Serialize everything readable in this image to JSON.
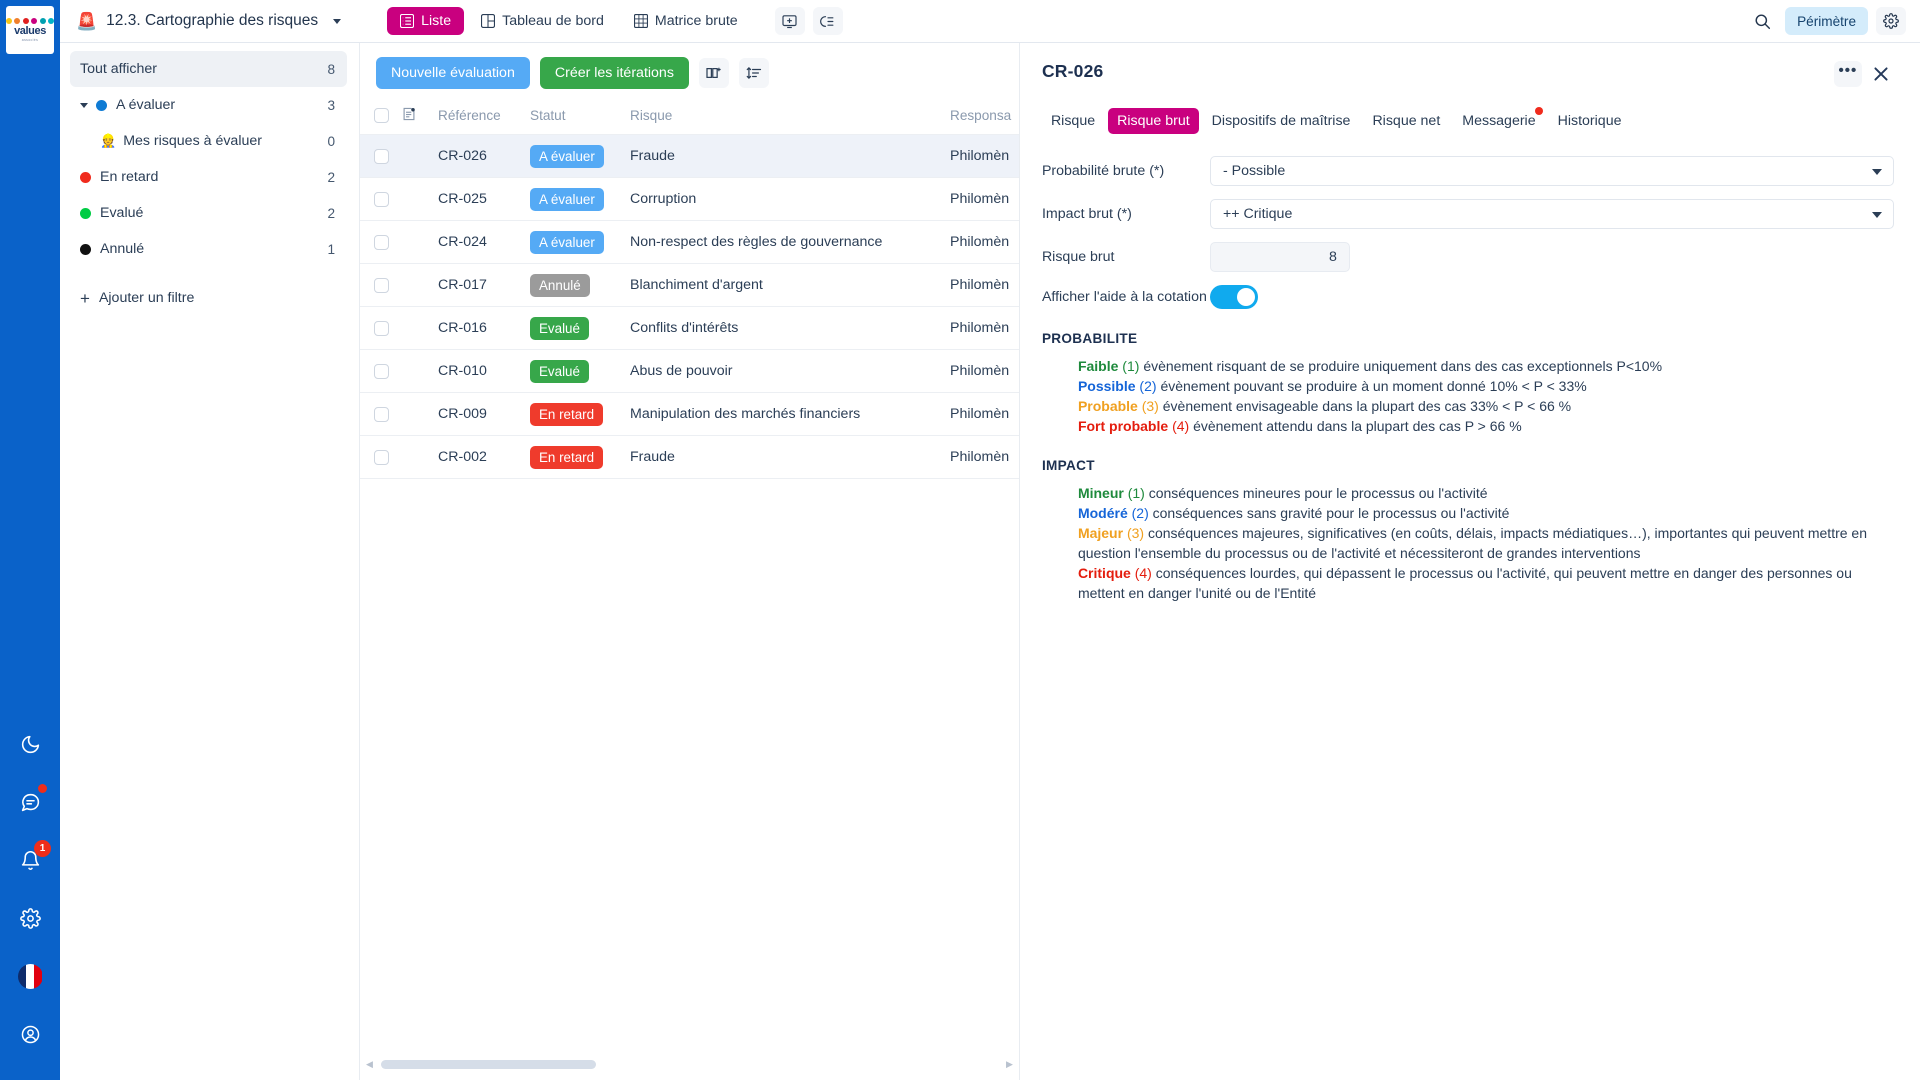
{
  "brand": {
    "logo_word": "values",
    "logo_sub": "associés",
    "logo_dot_colors": [
      "#f5c518",
      "#f07f2a",
      "#e02020",
      "#c9007f",
      "#00a0b0",
      "#00b3c8"
    ]
  },
  "topbar": {
    "app_emoji": "🚨",
    "app_title": "12.3. Cartographie des risques",
    "caret_icon": "chevron-down-icon",
    "tabs": [
      {
        "label": "Liste",
        "icon": "list-icon",
        "active": true
      },
      {
        "label": "Tableau de bord",
        "icon": "dashboard-icon",
        "active": false
      },
      {
        "label": "Matrice brute",
        "icon": "grid-icon",
        "active": false
      }
    ],
    "tools": [
      {
        "icon": "add-screen-icon"
      },
      {
        "icon": "collapse-list-icon"
      }
    ],
    "search_icon": "search-icon",
    "perimetre_label": "Périmètre",
    "gear_icon": "gear-icon"
  },
  "rail": {
    "icons": [
      {
        "name": "dark-mode-icon",
        "badge": null
      },
      {
        "name": "messages-icon",
        "badge": ""
      },
      {
        "name": "notifications-icon",
        "badge": "1"
      },
      {
        "name": "settings-icon",
        "badge": null
      },
      {
        "name": "language-flag-icon",
        "badge": null
      },
      {
        "name": "account-icon",
        "badge": null
      }
    ]
  },
  "filters": {
    "items": [
      {
        "label": "Tout afficher",
        "count": "8",
        "selected": true,
        "caret": false,
        "dot": null,
        "emoji": null,
        "indent": false
      },
      {
        "label": "A évaluer",
        "count": "3",
        "selected": false,
        "caret": true,
        "dot": "#0f7bd4",
        "emoji": null,
        "indent": false
      },
      {
        "label": "Mes risques à évaluer",
        "count": "0",
        "selected": false,
        "caret": false,
        "dot": null,
        "emoji": "👷",
        "indent": true
      },
      {
        "label": "En retard",
        "count": "2",
        "selected": false,
        "caret": false,
        "dot": "#f02b1d",
        "emoji": null,
        "indent": false
      },
      {
        "label": "Evalué",
        "count": "2",
        "selected": false,
        "caret": false,
        "dot": "#00cc44",
        "emoji": null,
        "indent": false
      },
      {
        "label": "Annulé",
        "count": "1",
        "selected": false,
        "caret": false,
        "dot": "#111111",
        "emoji": null,
        "indent": false
      }
    ],
    "add_filter_label": "Ajouter un filtre"
  },
  "list": {
    "buttons": {
      "new_evaluation": "Nouvelle évaluation",
      "create_iterations": "Créer les itérations"
    },
    "tools": [
      {
        "icon": "columns-add-icon"
      },
      {
        "icon": "sort-icon"
      }
    ],
    "columns": [
      "Référence",
      "Statut",
      "Risque",
      "Responsa"
    ],
    "header_note_icon": "note-icon",
    "rows": [
      {
        "flag": true,
        "ref": "CR-026",
        "status": "A évaluer",
        "status_type": "eval",
        "risk": "Fraude",
        "responsable": "Philomèn",
        "selected": true
      },
      {
        "flag": false,
        "ref": "CR-025",
        "status": "A évaluer",
        "status_type": "eval",
        "risk": "Corruption",
        "responsable": "Philomèn",
        "selected": false
      },
      {
        "flag": false,
        "ref": "CR-024",
        "status": "A évaluer",
        "status_type": "eval",
        "risk": "Non-respect des règles de gouvernance",
        "responsable": "Philomèn",
        "selected": false
      },
      {
        "flag": false,
        "ref": "CR-017",
        "status": "Annulé",
        "status_type": "annule",
        "risk": "Blanchiment d'argent",
        "responsable": "Philomèn",
        "selected": false
      },
      {
        "flag": false,
        "ref": "CR-016",
        "status": "Evalué",
        "status_type": "evalue",
        "risk": "Conflits d'intérêts",
        "responsable": "Philomèn",
        "selected": false
      },
      {
        "flag": false,
        "ref": "CR-010",
        "status": "Evalué",
        "status_type": "evalue",
        "risk": "Abus de pouvoir",
        "responsable": "Philomèn",
        "selected": false
      },
      {
        "flag": true,
        "ref": "CR-009",
        "status": "En retard",
        "status_type": "retard",
        "risk": "Manipulation des marchés financiers",
        "responsable": "Philomèn",
        "selected": false
      },
      {
        "flag": false,
        "ref": "CR-002",
        "status": "En retard",
        "status_type": "retard",
        "risk": "Fraude",
        "responsable": "Philomèn",
        "selected": false
      }
    ]
  },
  "detail": {
    "title": "CR-026",
    "more_icon": "more-options-icon",
    "close_icon": "close-icon",
    "tabs": [
      {
        "label": "Risque",
        "active": false,
        "dot": false
      },
      {
        "label": "Risque brut",
        "active": true,
        "dot": false
      },
      {
        "label": "Dispositifs de maîtrise",
        "active": false,
        "dot": false
      },
      {
        "label": "Risque net",
        "active": false,
        "dot": false
      },
      {
        "label": "Messagerie",
        "active": false,
        "dot": true
      },
      {
        "label": "Historique",
        "active": false,
        "dot": false
      }
    ],
    "form": {
      "probabilite_label": "Probabilité brute (*)",
      "probabilite_value": "- Possible",
      "impact_label": "Impact brut (*)",
      "impact_value": "++ Critique",
      "risque_brut_label": "Risque brut",
      "risque_brut_value": "8",
      "aide_label": "Afficher l'aide à la cotation",
      "aide_on": true
    },
    "probabilite": {
      "title": "PROBABILITE",
      "lines": [
        {
          "word": "Faible",
          "color": "green",
          "num": "(1)",
          "text": "évènement risquant de se produire uniquement dans des cas exceptionnels P<10%"
        },
        {
          "word": "Possible",
          "color": "blue",
          "num": "(2)",
          "text": "évènement pouvant se produire à un moment donné 10% < P < 33%"
        },
        {
          "word": "Probable",
          "color": "amber",
          "num": "(3)",
          "text": "évènement envisageable dans la plupart des cas 33% < P < 66 %"
        },
        {
          "word": "Fort probable",
          "color": "red",
          "num": "(4)",
          "text": "évènement attendu dans la plupart des cas P > 66 %"
        }
      ]
    },
    "impact": {
      "title": "IMPACT",
      "lines": [
        {
          "word": "Mineur",
          "color": "green",
          "num": "(1)",
          "text": "conséquences mineures pour le processus ou l'activité"
        },
        {
          "word": "Modéré",
          "color": "blue",
          "num": "(2)",
          "text": "conséquences sans gravité pour le processus ou l'activité"
        },
        {
          "word": "Majeur",
          "color": "amber",
          "num": "(3)",
          "text": "conséquences majeures, significatives (en coûts, délais, impacts médiatiques…), importantes qui peuvent mettre en question l'ensemble du processus ou de l'activité et nécessiteront de grandes interventions"
        },
        {
          "word": "Critique",
          "color": "red",
          "num": "(4)",
          "text": "conséquences lourdes, qui dépassent le processus ou l'activité, qui peuvent mettre en danger des personnes ou mettent en danger l'unité ou de l'Entité"
        }
      ]
    }
  },
  "colors": {
    "brand_magenta": "#c9007f",
    "rail_blue": "#0a62c9",
    "accent_blue": "#55aaf5",
    "accent_green": "#37a74a",
    "danger_red": "#ef3b2c"
  }
}
